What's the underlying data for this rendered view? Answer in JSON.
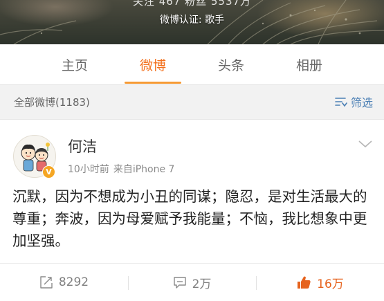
{
  "profile": {
    "banner_partial_text": "关注 467  粉丝 5537万",
    "verification": "微博认证: 歌手"
  },
  "tabs": [
    {
      "label": "主页"
    },
    {
      "label": "微博"
    },
    {
      "label": "头条"
    },
    {
      "label": "相册"
    }
  ],
  "active_tab": "微博",
  "filter_bar": {
    "post_count": "全部微博(1183)",
    "filter_label": "筛选"
  },
  "post": {
    "author": "何洁",
    "time": "10小时前",
    "source": "来自iPhone 7",
    "verified_badge": "V",
    "text": "沉默，因为不想成为小丑的同谋；隐忍，是对生活最大的尊重；奔波，因为母爱赋予我能量；不恼，我比想象中更加坚强。",
    "reposts": "8292",
    "comments": "2万",
    "likes": "16万"
  },
  "colors": {
    "accent_orange": "#f3701d",
    "link_blue": "#4b7fb4",
    "badge_gold": "#f5a623"
  },
  "icons": [
    "repost-icon",
    "comment-icon",
    "like-icon",
    "filter-icon",
    "chevron-down-icon"
  ]
}
